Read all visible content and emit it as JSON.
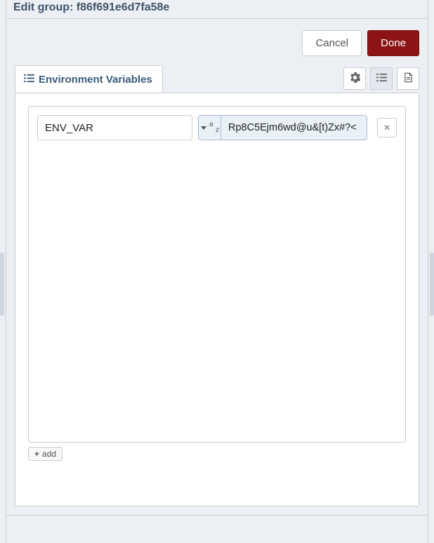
{
  "header": {
    "title": "Edit group: f86f691e6d7fa58e"
  },
  "buttons": {
    "cancel": "Cancel",
    "done": "Done"
  },
  "tab": {
    "label": "Environment Variables"
  },
  "vars": [
    {
      "name": "ENV_VAR",
      "value": "Rp8C5Ejm6wd@u&[t)Zx#?<"
    }
  ],
  "add": {
    "label": "add"
  }
}
